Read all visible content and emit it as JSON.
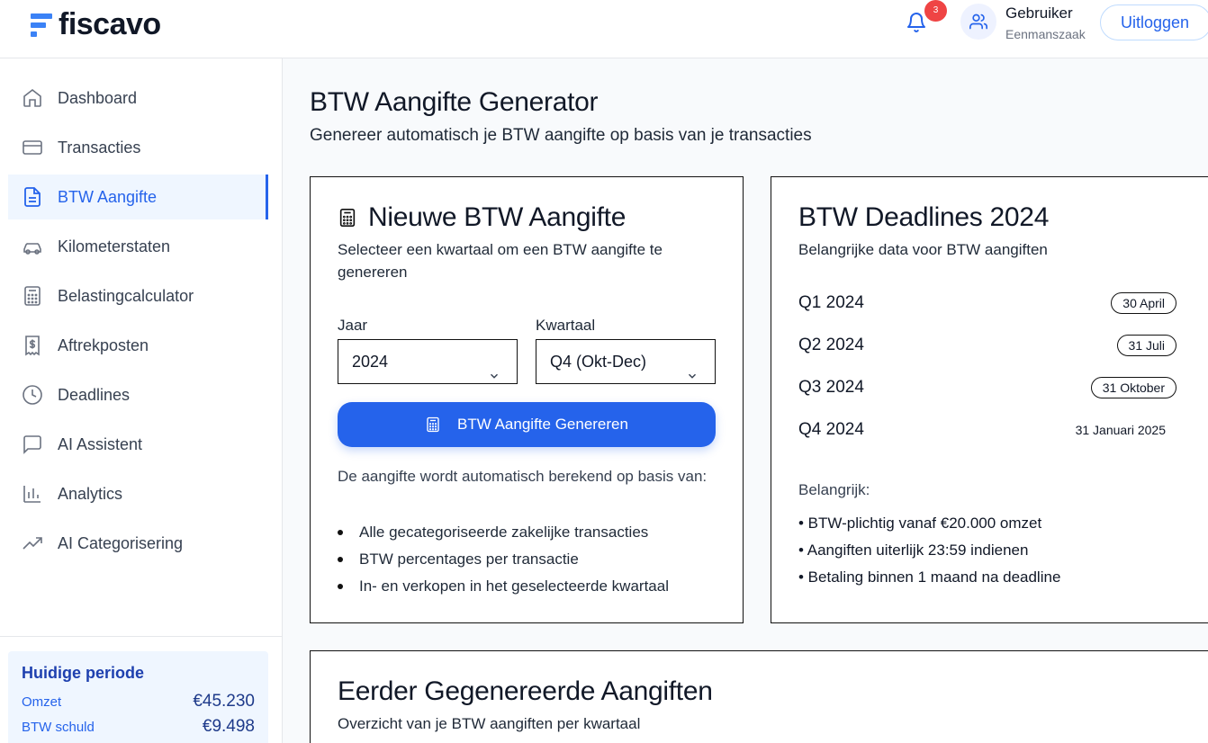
{
  "header": {
    "brand": "fiscavo",
    "notification_count": "3",
    "user_name": "Gebruiker",
    "user_type": "Eenmanszaak",
    "logout_label": "Uitloggen"
  },
  "sidebar": {
    "items": [
      {
        "label": "Dashboard",
        "icon": "home-icon"
      },
      {
        "label": "Transacties",
        "icon": "credit-card-icon"
      },
      {
        "label": "BTW Aangifte",
        "icon": "document-icon"
      },
      {
        "label": "Kilometerstaten",
        "icon": "car-icon"
      },
      {
        "label": "Belastingcalculator",
        "icon": "calculator-icon"
      },
      {
        "label": "Aftrekposten",
        "icon": "receipt-dollar-icon"
      },
      {
        "label": "Deadlines",
        "icon": "clock-icon"
      },
      {
        "label": "AI Assistent",
        "icon": "chat-icon"
      },
      {
        "label": "Analytics",
        "icon": "bar-chart-icon"
      },
      {
        "label": "AI Categorisering",
        "icon": "trending-up-icon"
      }
    ],
    "active_index": 2,
    "period": {
      "title": "Huidige periode",
      "revenue_label": "Omzet",
      "revenue_value": "€45.230",
      "vat_label": "BTW schuld",
      "vat_value": "€9.498"
    }
  },
  "page": {
    "title": "BTW Aangifte Generator",
    "subtitle": "Genereer automatisch je BTW aangifte op basis van je transacties"
  },
  "new_return": {
    "title": "Nieuwe BTW Aangifte",
    "description": "Selecteer een kwartaal om een BTW aangifte te genereren",
    "year_label": "Jaar",
    "year_value": "2024",
    "quarter_label": "Kwartaal",
    "quarter_value": "Q4 (Okt-Dec)",
    "button_label": "BTW Aangifte Genereren",
    "info": "De aangifte wordt automatisch berekend op basis van:",
    "bullets": [
      "Alle gecategoriseerde zakelijke transacties",
      "BTW percentages per transactie",
      "In- en verkopen in het geselecteerde kwartaal"
    ]
  },
  "deadlines": {
    "title": "BTW Deadlines 2024",
    "subtitle": "Belangrijke data voor BTW aangiften",
    "rows": [
      {
        "quarter": "Q1 2024",
        "date": "30 April"
      },
      {
        "quarter": "Q2 2024",
        "date": "31 Juli"
      },
      {
        "quarter": "Q3 2024",
        "date": "31 Oktober"
      },
      {
        "quarter": "Q4 2024",
        "date": "31 Januari 2025"
      }
    ],
    "important_label": "Belangrijk:",
    "important_items": [
      "• BTW-plichtig vanaf €20.000 omzet",
      "• Aangiften uiterlijk 23:59 indienen",
      "• Betaling binnen 1 maand na deadline"
    ]
  },
  "previous": {
    "title": "Eerder Gegenereerde Aangiften",
    "subtitle": "Overzicht van je BTW aangiften per kwartaal"
  }
}
